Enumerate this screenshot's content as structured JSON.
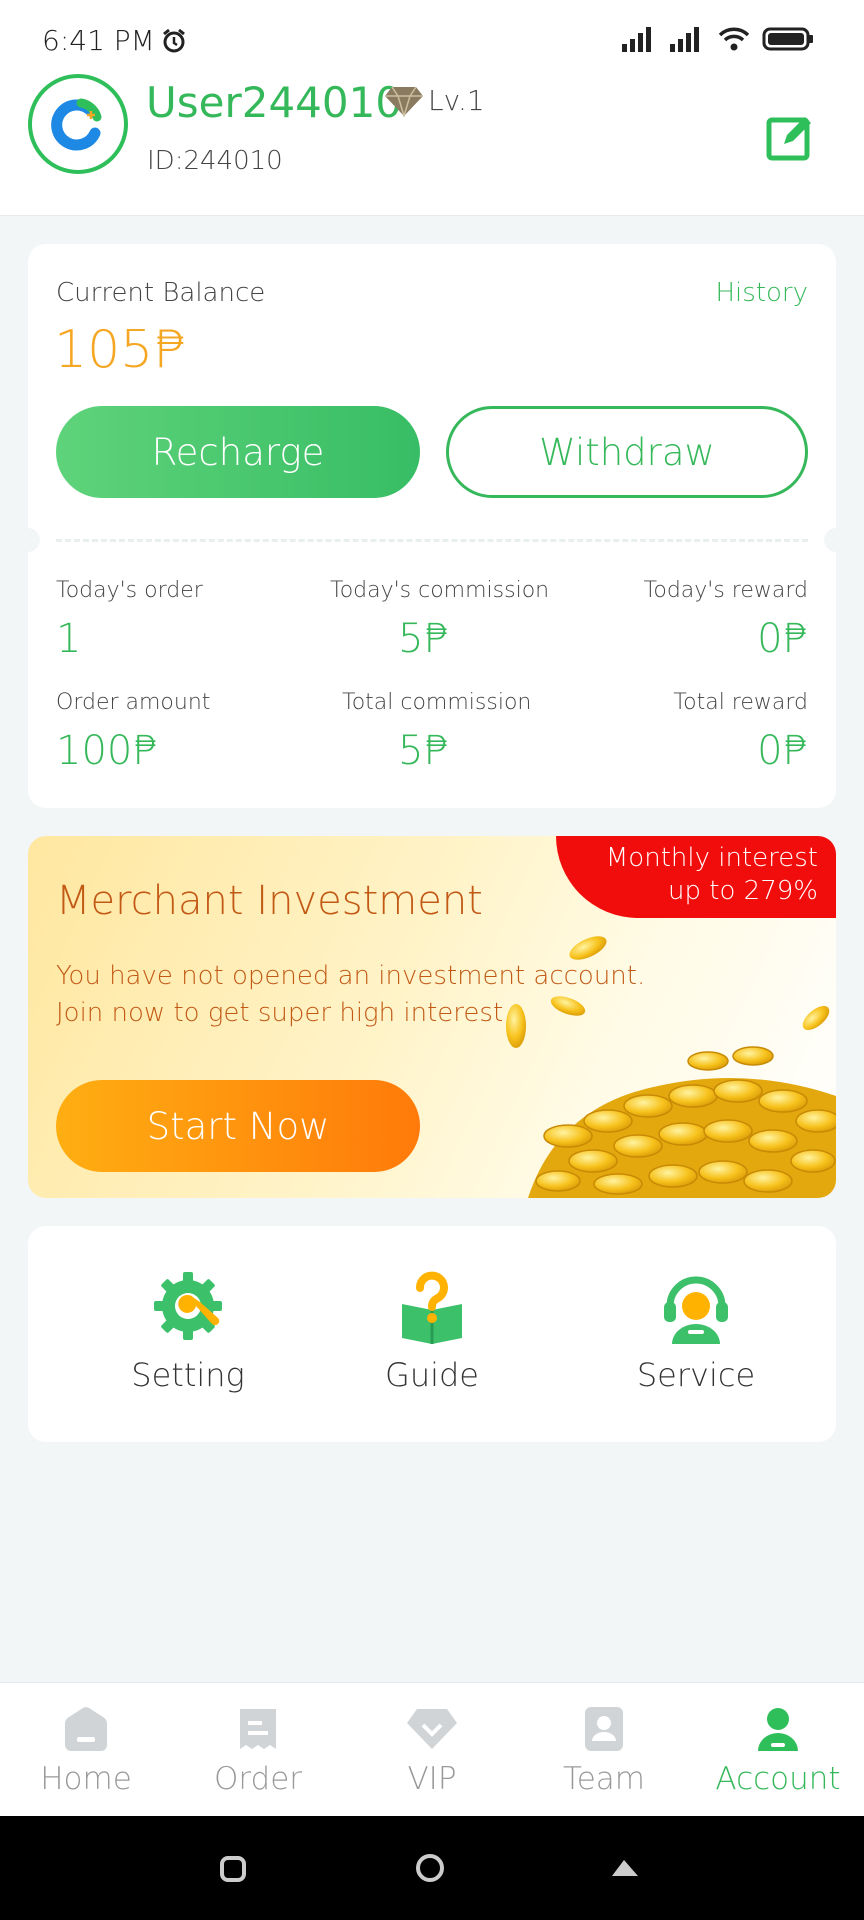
{
  "status_bar": {
    "time": "6:41 PM"
  },
  "profile": {
    "username": "User244010",
    "level": "Lv.1",
    "id_text": "ID:244010"
  },
  "balance": {
    "label": "Current Balance",
    "history_label": "History",
    "value": "105₱",
    "recharge_label": "Recharge",
    "withdraw_label": "Withdraw"
  },
  "stats": [
    {
      "label": "Today's order",
      "value": "1"
    },
    {
      "label": "Today's commission",
      "value": "5₱"
    },
    {
      "label": "Today's reward",
      "value": "0₱"
    },
    {
      "label": "Order amount",
      "value": "100₱"
    },
    {
      "label": "Total commission",
      "value": "5₱"
    },
    {
      "label": "Total reward",
      "value": "0₱"
    }
  ],
  "investment": {
    "ribbon_line1": "Monthly interest",
    "ribbon_line2": "up to 279%",
    "title": "Merchant Investment",
    "desc_line1": "You have not opened an investment account.",
    "desc_line2": "Join now to get super high interest.",
    "button_label": "Start Now"
  },
  "tools": [
    {
      "label": "Setting",
      "icon": "gear-wrench-icon"
    },
    {
      "label": "Guide",
      "icon": "question-book-icon"
    },
    {
      "label": "Service",
      "icon": "headset-agent-icon"
    }
  ],
  "nav": [
    {
      "label": "Home",
      "icon": "home-icon"
    },
    {
      "label": "Order",
      "icon": "receipt-icon"
    },
    {
      "label": "VIP",
      "icon": "diamond-icon"
    },
    {
      "label": "Team",
      "icon": "team-card-icon"
    },
    {
      "label": "Account",
      "icon": "user-icon",
      "active": true
    }
  ],
  "colors": {
    "accent": "#35b85a",
    "balance": "#f5a623",
    "investment_text": "#c25a16",
    "ribbon": "#f20d0d"
  }
}
